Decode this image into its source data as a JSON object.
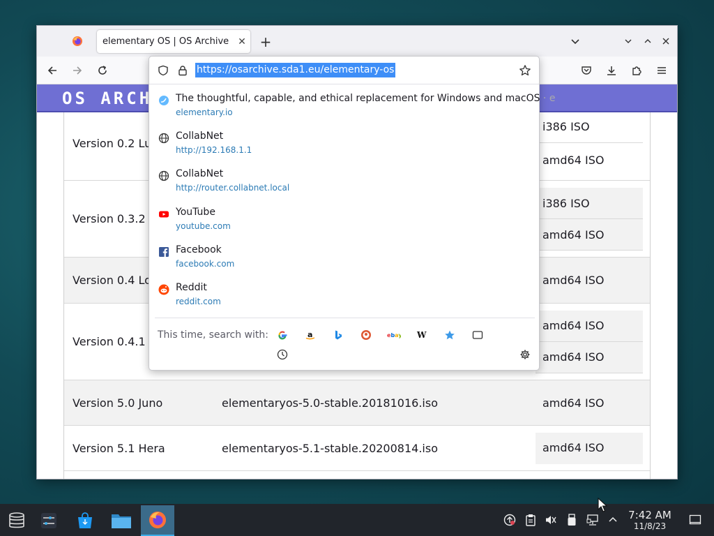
{
  "tab": {
    "title": "elementary OS | OS Archive",
    "close": "✕",
    "new_tab": "+"
  },
  "urlbar": {
    "url": "https://osarchive.sda1.eu/elementary-os"
  },
  "site": {
    "logo": "OS ARCH"
  },
  "table": {
    "rows": [
      {
        "version": "Version 0.2 Lur",
        "file": "",
        "types": [
          "i386 ISO",
          "amd64 ISO"
        ]
      },
      {
        "version": "Version 0.3.2 Fr",
        "file": "",
        "types": [
          "i386 ISO",
          "amd64 ISO"
        ]
      },
      {
        "version": "Version 0.4 Lok",
        "file": "",
        "types": [
          "amd64 ISO"
        ]
      },
      {
        "version": "Version 0.4.1 Lo",
        "file": "",
        "types": [
          "amd64 ISO",
          "amd64 ISO"
        ]
      },
      {
        "version": "Version 5.0 Juno",
        "file": "elementaryos-5.0-stable.20181016.iso",
        "types": [
          "amd64 ISO"
        ]
      },
      {
        "version": "Version 5.1 Hera",
        "file": "elementaryos-5.1-stable.20200814.iso",
        "types": [
          "amd64 ISO"
        ]
      }
    ]
  },
  "suggestions": [
    {
      "title": "The thoughtful, capable, and ethical replacement for Windows and macOS",
      "extra": " · e",
      "url": "elementary.io",
      "icon": "elementary-icon"
    },
    {
      "title": "CollabNet",
      "url": "http://192.168.1.1",
      "icon": "globe-icon"
    },
    {
      "title": "CollabNet",
      "url": "http://router.collabnet.local",
      "icon": "globe-icon"
    },
    {
      "title": "YouTube",
      "url": "youtube.com",
      "icon": "youtube-icon"
    },
    {
      "title": "Facebook",
      "url": "facebook.com",
      "icon": "facebook-icon"
    },
    {
      "title": "Reddit",
      "url": "reddit.com",
      "icon": "reddit-icon"
    }
  ],
  "search": {
    "label": "This time, search with:",
    "engines": [
      "google",
      "amazon",
      "bing",
      "duckduckgo",
      "ebay",
      "wikipedia",
      "bookmarks",
      "tabs",
      "history"
    ]
  },
  "clock": {
    "time": "7:42 AM",
    "date": "11/8/23"
  },
  "colors": {
    "accent": "#3e8ef7",
    "site_header": "#6f6fd3",
    "link": "#2c7bb5",
    "taskbar": "#21252b"
  }
}
